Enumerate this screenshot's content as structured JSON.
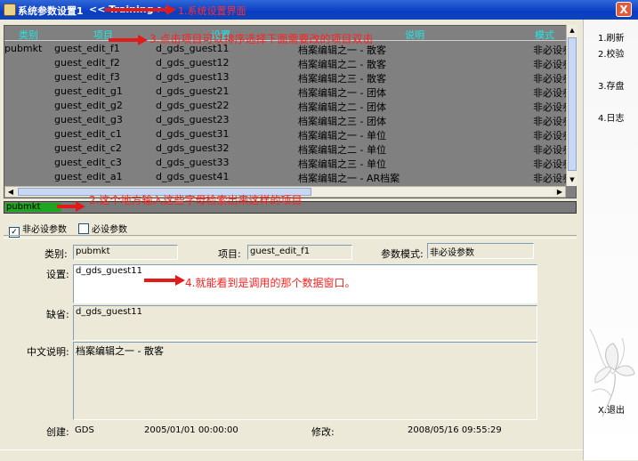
{
  "window": {
    "title": "系统参数设置1",
    "subtitle": "<< Training >>",
    "close_label": "X"
  },
  "annotations": {
    "a1": "1.系统设置界面",
    "a2": "2.这个地方输入这些字母检索出来这样的项目",
    "a3": "3.点击项目可以排序选择下面需要改的项目双击",
    "a4": "4.就能看到是调用的那个数据窗口。"
  },
  "grid": {
    "headers": [
      "类别",
      "项目",
      "设置",
      "说明",
      "模式"
    ],
    "rows": [
      [
        "pubmkt",
        "guest_edit_f1",
        "d_gds_guest11",
        "档案编辑之一 - 散客",
        "非必设参"
      ],
      [
        "",
        "guest_edit_f2",
        "d_gds_guest12",
        "档案编辑之二 - 散客",
        "非必设参"
      ],
      [
        "",
        "guest_edit_f3",
        "d_gds_guest13",
        "档案编辑之三 - 散客",
        "非必设参"
      ],
      [
        "",
        "guest_edit_g1",
        "d_gds_guest21",
        "档案编辑之一 - 团体",
        "非必设参"
      ],
      [
        "",
        "guest_edit_g2",
        "d_gds_guest22",
        "档案编辑之二 - 团体",
        "非必设参"
      ],
      [
        "",
        "guest_edit_g3",
        "d_gds_guest23",
        "档案编辑之三 - 团体",
        "非必设参"
      ],
      [
        "",
        "guest_edit_c1",
        "d_gds_guest31",
        "档案编辑之一 - 单位",
        "非必设参"
      ],
      [
        "",
        "guest_edit_c2",
        "d_gds_guest32",
        "档案编辑之二 - 单位",
        "非必设参"
      ],
      [
        "",
        "guest_edit_c3",
        "d_gds_guest33",
        "档案编辑之三 - 单位",
        "非必设参"
      ],
      [
        "",
        "guest_edit_a1",
        "d_gds_guest41",
        "档案编辑之一 - AR档案",
        "非必设参"
      ]
    ]
  },
  "search": {
    "value": "pubmkt"
  },
  "filters": {
    "optional_label": "非必设参数",
    "optional_checked": "✓",
    "required_label": "必设参数"
  },
  "detail": {
    "category_label": "类别:",
    "category_value": "pubmkt",
    "item_label": "项目:",
    "item_value": "guest_edit_f1",
    "mode_label": "参数模式:",
    "mode_value": "非必设参数",
    "setting_label": "设置:",
    "setting_value": "d_gds_guest11",
    "default_label": "缺省:",
    "default_value": "d_gds_guest11",
    "desc_label": "中文说明:",
    "desc_value": "档案编辑之一 - 散客",
    "created_label": "创建:",
    "created_by": "GDS",
    "created_date": "2005/01/01 00:00:00",
    "modified_label": "修改:",
    "modified_date": "2008/05/16 09:55:29"
  },
  "sidebar": {
    "refresh": "1.刷新",
    "verify": "2.校验",
    "save": "3.存盘",
    "log": "4.日志",
    "exit": "X.退出"
  },
  "colors": {
    "titlebar": "#0a3cc4",
    "grid_bg": "#808080",
    "header_text": "#22e6e6",
    "search_bg": "#1fa51f",
    "annotation": "#ff2020"
  }
}
